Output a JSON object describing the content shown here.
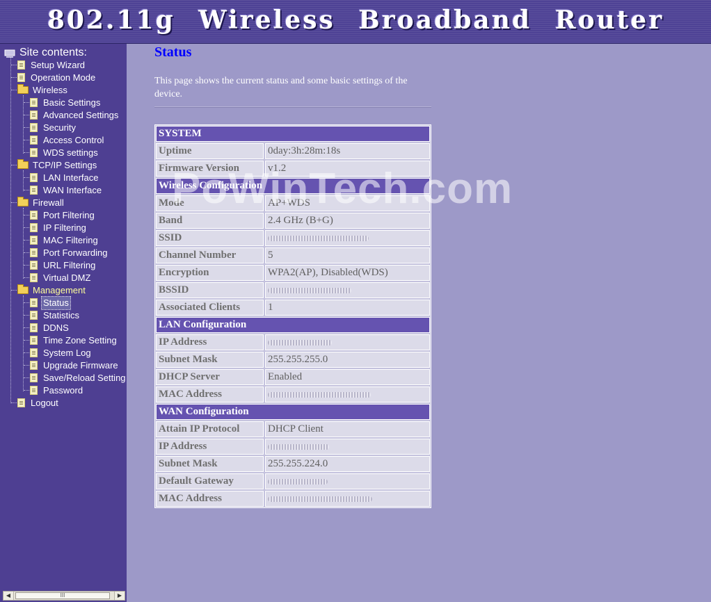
{
  "header": {
    "title": "802.11g  Wireless Broadband Router"
  },
  "sidebar": {
    "root_label": "Site contents:",
    "items": {
      "setup_wizard": "Setup Wizard",
      "operation_mode": "Operation Mode",
      "wireless": "Wireless",
      "basic_settings": "Basic Settings",
      "advanced_settings": "Advanced Settings",
      "security": "Security",
      "access_control": "Access Control",
      "wds_settings": "WDS settings",
      "tcpip_settings": "TCP/IP Settings",
      "lan_interface": "LAN Interface",
      "wan_interface": "WAN Interface",
      "firewall": "Firewall",
      "port_filtering": "Port Filtering",
      "ip_filtering": "IP Filtering",
      "mac_filtering": "MAC Filtering",
      "port_forwarding": "Port Forwarding",
      "url_filtering": "URL Filtering",
      "virtual_dmz": "Virtual DMZ",
      "management": "Management",
      "status": "Status",
      "statistics": "Statistics",
      "ddns": "DDNS",
      "time_zone_setting": "Time Zone Setting",
      "system_log": "System Log",
      "upgrade_firmware": "Upgrade Firmware",
      "save_reload_setting": "Save/Reload Setting",
      "password": "Password",
      "logout": "Logout"
    },
    "selected": "Status",
    "scrollbar_thumb": "III"
  },
  "main": {
    "title": "Status",
    "description": "This page shows the current status and some basic settings of the device.",
    "watermark": "PoWinTech.com",
    "system": {
      "header": "SYSTEM",
      "uptime_label": "Uptime",
      "uptime_value": "0day:3h:28m:18s",
      "firmware_label": "Firmware Version",
      "firmware_value": "v1.2"
    },
    "wireless": {
      "header": "Wireless Configuration",
      "mode_label": "Mode",
      "mode_value": "AP+WDS",
      "band_label": "Band",
      "band_value": "2.4 GHz (B+G)",
      "ssid_label": "SSID",
      "channel_label": "Channel Number",
      "channel_value": "5",
      "encryption_label": "Encryption",
      "encryption_value": "WPA2(AP), Disabled(WDS)",
      "bssid_label": "BSSID",
      "clients_label": "Associated Clients",
      "clients_value": "1"
    },
    "lan": {
      "header": "LAN Configuration",
      "ip_label": "IP Address",
      "mask_label": "Subnet Mask",
      "mask_value": "255.255.255.0",
      "dhcp_label": "DHCP Server",
      "dhcp_value": "Enabled",
      "mac_label": "MAC Address"
    },
    "wan": {
      "header": "WAN Configuration",
      "protocol_label": "Attain IP Protocol",
      "protocol_value": "DHCP Client",
      "ip_label": "IP Address",
      "mask_label": "Subnet Mask",
      "mask_value": "255.255.224.0",
      "gateway_label": "Default Gateway",
      "mac_label": "MAC Address"
    }
  }
}
